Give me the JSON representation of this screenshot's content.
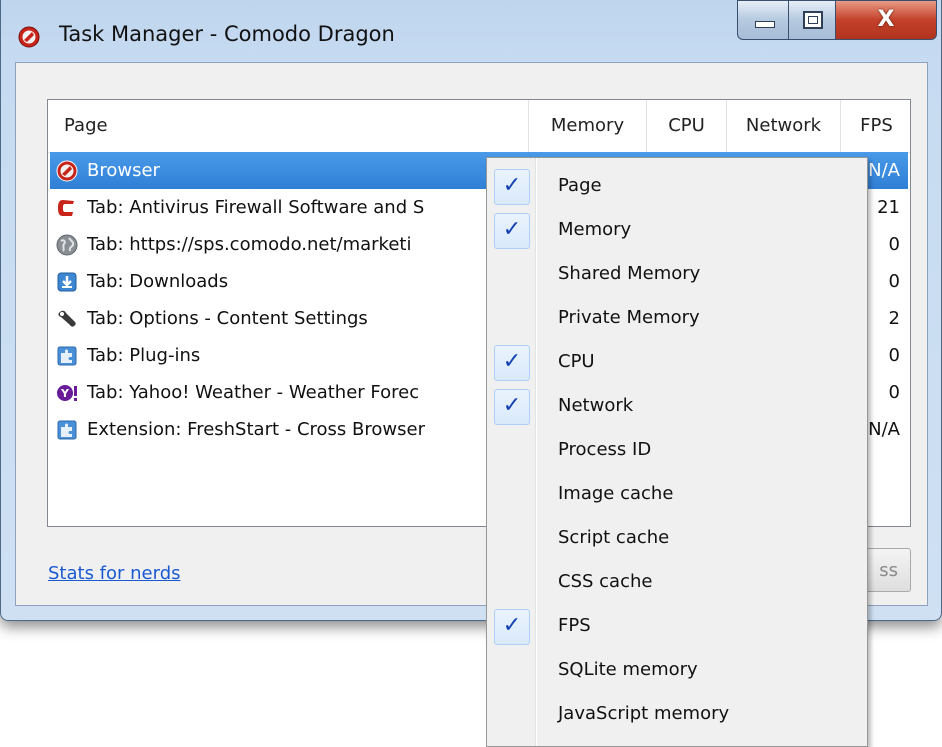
{
  "window": {
    "title": "Task Manager - Comodo Dragon",
    "app_icon": "comodo-dragon-icon",
    "controls": {
      "minimize_icon": "minimize-icon",
      "maximize_icon": "maximize-icon",
      "close_glyph": "X"
    }
  },
  "table": {
    "columns": [
      "Page",
      "Memory",
      "CPU",
      "Network",
      "FPS"
    ],
    "rows": [
      {
        "icon": "comodo-dragon-icon",
        "label": "Browser",
        "fps": "N/A",
        "selected": true
      },
      {
        "icon": "comodo-c-icon",
        "label": "Tab: Antivirus Firewall Software and S",
        "fps": "21"
      },
      {
        "icon": "globe-icon",
        "label": "Tab: https://sps.comodo.net/marketi",
        "fps": "0"
      },
      {
        "icon": "download-icon",
        "label": "Tab: Downloads",
        "fps": "0"
      },
      {
        "icon": "wrench-icon",
        "label": "Tab: Options - Content Settings",
        "fps": "2"
      },
      {
        "icon": "puzzle-icon",
        "label": "Tab: Plug-ins",
        "fps": "0"
      },
      {
        "icon": "yahoo-icon",
        "label": "Tab: Yahoo! Weather - Weather Forec",
        "fps": "0"
      },
      {
        "icon": "puzzle-icon",
        "label": "Extension: FreshStart - Cross Browser",
        "fps": "N/A"
      }
    ]
  },
  "footer": {
    "stats_link": "Stats for nerds",
    "end_process_visible_text": "ss"
  },
  "context_menu": {
    "items": [
      {
        "label": "Page",
        "checked": true
      },
      {
        "label": "Memory",
        "checked": true
      },
      {
        "label": "Shared Memory",
        "checked": false
      },
      {
        "label": "Private Memory",
        "checked": false
      },
      {
        "label": "CPU",
        "checked": true
      },
      {
        "label": "Network",
        "checked": true
      },
      {
        "label": "Process ID",
        "checked": false
      },
      {
        "label": "Image cache",
        "checked": false
      },
      {
        "label": "Script cache",
        "checked": false
      },
      {
        "label": "CSS cache",
        "checked": false
      },
      {
        "label": "FPS",
        "checked": true
      },
      {
        "label": "SQLite memory",
        "checked": false
      },
      {
        "label": "JavaScript memory",
        "checked": false
      }
    ],
    "check_glyph": "✓"
  },
  "colors": {
    "selection": "#3b8de0",
    "link": "#1a5ad1",
    "check": "#1440b4",
    "comodo_red": "#c8241a"
  }
}
